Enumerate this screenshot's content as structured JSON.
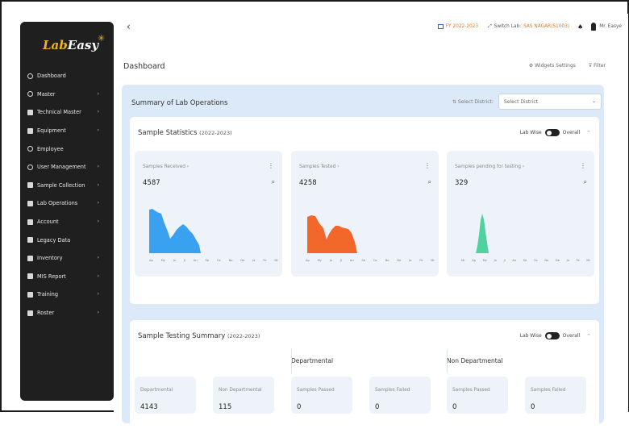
{
  "app": {
    "logo_part1": "Lab",
    "logo_part2": "Easy",
    "logo_mark": "✳"
  },
  "sidebar": {
    "items": [
      {
        "label": "Dashboard",
        "icon": "home-icon",
        "arrow": ""
      },
      {
        "label": "Master",
        "icon": "user-icon",
        "arrow": "›"
      },
      {
        "label": "Technical Master",
        "icon": "grid-icon",
        "arrow": "›"
      },
      {
        "label": "Equipment",
        "icon": "grid-icon",
        "arrow": "›"
      },
      {
        "label": "Employee",
        "icon": "user-icon",
        "arrow": ""
      },
      {
        "label": "User Management",
        "icon": "user-icon",
        "arrow": "›"
      },
      {
        "label": "Sample Collection",
        "icon": "doc-icon",
        "arrow": "›"
      },
      {
        "label": "Lab Operations",
        "icon": "doc-icon",
        "arrow": "›"
      },
      {
        "label": "Account",
        "icon": "doc-icon",
        "arrow": "›"
      },
      {
        "label": "Legacy Data",
        "icon": "doc-icon",
        "arrow": ""
      },
      {
        "label": "Inventory",
        "icon": "doc-icon",
        "arrow": "›"
      },
      {
        "label": "MIS Report",
        "icon": "doc-icon",
        "arrow": "›"
      },
      {
        "label": "Training",
        "icon": "doc-icon",
        "arrow": "›"
      },
      {
        "label": "Roster",
        "icon": "doc-icon",
        "arrow": "›"
      }
    ]
  },
  "topbar": {
    "back": "‹",
    "fy": "FY 2022-2023",
    "switch_label": "Switch Lab:",
    "lab_name": "SAS NAGAR(S1003)",
    "bell": "♠",
    "user_name": "Mr. Easye"
  },
  "page": {
    "title": "Dashboard",
    "widgets_settings": "⚙ Widgets Settings",
    "filter": "⊽ Filter"
  },
  "summary": {
    "title": "Summary of Lab Operations",
    "district_label": "⇅ Select District:",
    "district_placeholder": "Select District",
    "caret": "⌄"
  },
  "sample_statistics": {
    "title": "Sample Statistics",
    "period": "(2022-2023)",
    "toggle_left": "Lab Wise",
    "toggle_right": "Overall",
    "cards": [
      {
        "title": "Samples Received ›",
        "value": "4587",
        "color": "#3aa0f0",
        "months": [
          "Ap",
          "My",
          "Jn",
          "Jl",
          "Au",
          "Se",
          "Oc",
          "No",
          "De",
          "Ja",
          "Fe",
          "Mr"
        ]
      },
      {
        "title": "Samples Tested ›",
        "value": "4258",
        "color": "#f2672a",
        "months": [
          "Ap",
          "My",
          "Jn",
          "Jl",
          "Au",
          "Se",
          "Oc",
          "No",
          "De",
          "Ja",
          "Fe",
          "Mr"
        ]
      },
      {
        "title": "Samples pending for testing ›",
        "value": "329",
        "color": "#4fd1a0",
        "months": [
          "Mr",
          "Ap",
          "My",
          "Jn",
          "Jl",
          "Au",
          "Se",
          "Oc",
          "No",
          "De",
          "Ja",
          "Fe",
          "Mr"
        ]
      }
    ]
  },
  "sample_testing": {
    "title": "Sample Testing Summary",
    "period": "(2022-2023)",
    "toggle_left": "Lab Wise",
    "toggle_right": "Overall",
    "group_departmental": "Departmental",
    "group_non_departmental": "Non Departmental",
    "boxes": [
      {
        "label": "Departmental",
        "value": "4143"
      },
      {
        "label": "Non Departmental",
        "value": "115"
      },
      {
        "label": "Samples Passed",
        "value": "0"
      },
      {
        "label": "Samples Failed",
        "value": "0"
      },
      {
        "label": "Samples Passed",
        "value": "0"
      },
      {
        "label": "Samples Failed",
        "value": "0"
      }
    ]
  }
}
